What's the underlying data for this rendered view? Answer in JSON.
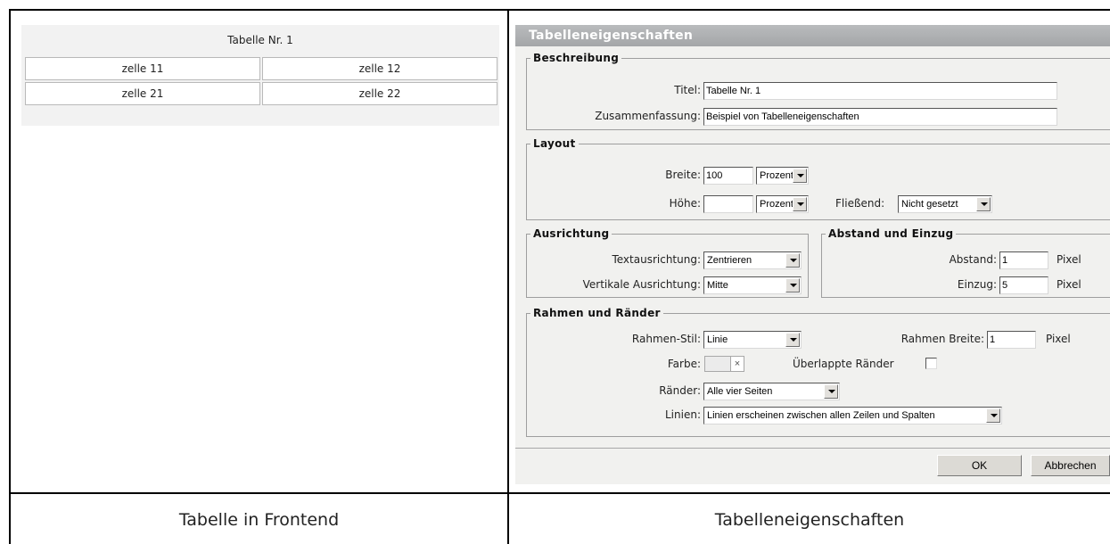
{
  "captions": {
    "left": "Tabelle in Frontend",
    "right": "Tabelleneigenschaften"
  },
  "frontend": {
    "title": "Tabelle Nr. 1",
    "rows": [
      [
        "zelle 11",
        "zelle 12"
      ],
      [
        "zelle 21",
        "zelle 22"
      ]
    ]
  },
  "dialog": {
    "title": "Tabelleneigenschaften",
    "beschreibung": {
      "legend": "Beschreibung",
      "titel_label": "Titel:",
      "titel_value": "Tabelle Nr. 1",
      "zusammenfassung_label": "Zusammenfassung:",
      "zusammenfassung_value": "Beispiel von Tabelleneigenschaften"
    },
    "layout": {
      "legend": "Layout",
      "breite_label": "Breite:",
      "breite_value": "100",
      "breite_unit": "Prozent",
      "hoehe_label": "Höhe:",
      "hoehe_value": "",
      "hoehe_unit": "Prozent",
      "fliessend_label": "Fließend:",
      "fliessend_value": "Nicht gesetzt"
    },
    "ausrichtung": {
      "legend": "Ausrichtung",
      "text_label": "Textausrichtung:",
      "text_value": "Zentrieren",
      "vertikal_label": "Vertikale Ausrichtung:",
      "vertikal_value": "Mitte"
    },
    "abstand": {
      "legend": "Abstand und Einzug",
      "abstand_label": "Abstand:",
      "abstand_value": "1",
      "einzug_label": "Einzug:",
      "einzug_value": "5",
      "unit": "Pixel"
    },
    "rahmen": {
      "legend": "Rahmen und Ränder",
      "stil_label": "Rahmen-Stil:",
      "stil_value": "Linie",
      "breite_label": "Rahmen Breite:",
      "breite_value": "1",
      "breite_unit": "Pixel",
      "farbe_label": "Farbe:",
      "farbe_clear": "×",
      "ueberlappt_label": "Überlappte Ränder",
      "raender_label": "Ränder:",
      "raender_value": "Alle vier Seiten",
      "linien_label": "Linien:",
      "linien_value": "Linien erscheinen zwischen allen Zeilen und Spalten"
    },
    "buttons": {
      "ok": "OK",
      "cancel": "Abbrechen"
    }
  }
}
